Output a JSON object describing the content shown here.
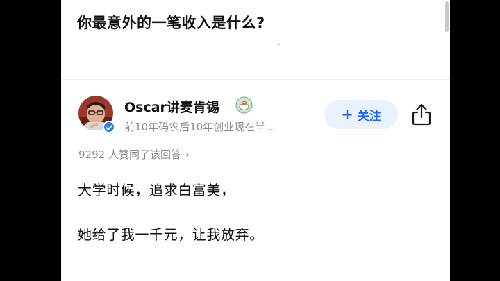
{
  "question": {
    "title": "你最意外的一笔收入是什么?"
  },
  "author": {
    "name": "Oscar讲麦肯锡",
    "bio": "前10年码农后10年创业现在半...",
    "avatar_icon": "avatar",
    "verified_icon": "verified-check-icon",
    "badge_icon": "creator-badge-icon"
  },
  "actions": {
    "follow_label": "关注",
    "follow_icon": "plus-icon",
    "share_icon": "share-icon"
  },
  "answer": {
    "vote_text": "9292 人赞同了该回答",
    "vote_chevron": "›",
    "paragraphs": [
      "大学时候，追求白富美，",
      "她给了我一千元，让我放弃。"
    ]
  },
  "colors": {
    "accent": "#1a66ff",
    "follow_bg": "#eaf1ff",
    "text_primary": "#121212",
    "text_secondary": "#8a8a8a",
    "verified": "#2f7df6"
  }
}
